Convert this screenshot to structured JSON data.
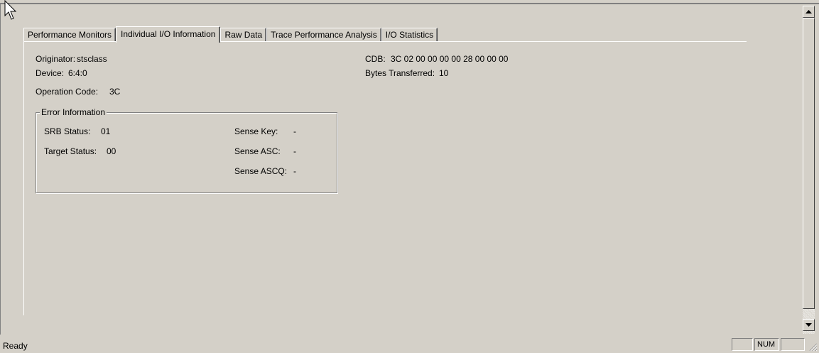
{
  "tabs": [
    {
      "label": "Performance Monitors",
      "active": false
    },
    {
      "label": "Individual I/O Information",
      "active": true
    },
    {
      "label": "Raw Data",
      "active": false
    },
    {
      "label": "Trace Performance Analysis",
      "active": false
    },
    {
      "label": "I/O Statistics",
      "active": false
    }
  ],
  "io_info": {
    "originator_label": "Originator:",
    "originator_value": "stsclass",
    "device_label": "Device:",
    "device_value": "6:4:0",
    "opcode_label": "Operation Code:",
    "opcode_value": "3C",
    "cdb_label": "CDB:",
    "cdb_value": "3C 02 00 00 00 00 28 00 00 00",
    "bytes_label": "Bytes Transferred:",
    "bytes_value": "10"
  },
  "error_info": {
    "title": "Error Information",
    "srb_label": "SRB Status:",
    "srb_value": "01",
    "target_label": "Target Status:",
    "target_value": "00",
    "sense_key_label": "Sense Key:",
    "sense_key_value": "-",
    "sense_asc_label": "Sense ASC:",
    "sense_asc_value": "-",
    "sense_ascq_label": "Sense ASCQ:",
    "sense_ascq_value": "-"
  },
  "status_bar": {
    "text": "Ready",
    "panes": [
      "",
      "NUM",
      ""
    ]
  },
  "icons": [
    "mouse-cursor-icon",
    "scroll-up-arrow-icon",
    "scroll-down-arrow-icon",
    "resize-grip-icon"
  ]
}
